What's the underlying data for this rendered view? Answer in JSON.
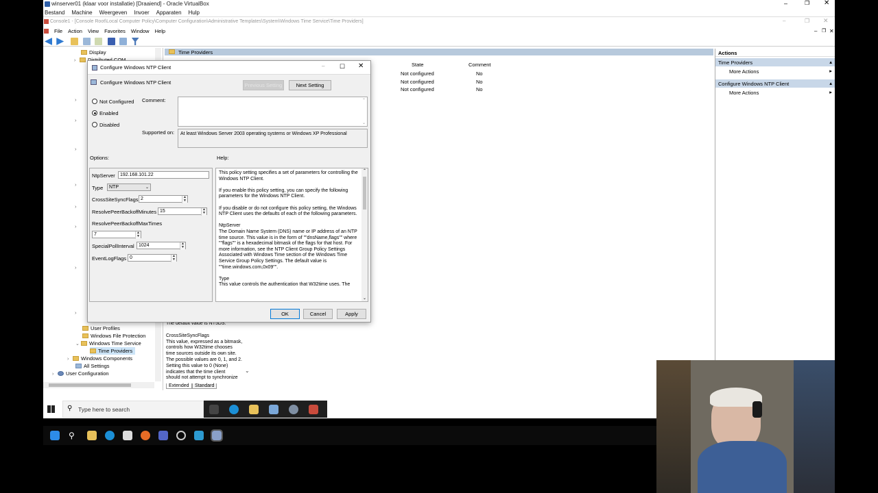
{
  "vbox": {
    "title": "winserver01 (klaar voor installatie) [Draaiend] - Oracle VirtualBox",
    "menu": [
      "Bestand",
      "Machine",
      "Weergeven",
      "Invoer",
      "Apparaten",
      "Hulp"
    ]
  },
  "mmc": {
    "title": "Console1 - [Console Root\\Local Computer Policy\\Computer Configuration\\Administrative Templates\\System\\Windows Time Service\\Time Providers]",
    "menu": [
      "File",
      "Action",
      "View",
      "Favorites",
      "Window",
      "Help"
    ]
  },
  "tree": {
    "top_items": [
      "Display",
      "Distributed COM"
    ],
    "bottom_items": [
      {
        "label": "User Profiles",
        "indent": 2
      },
      {
        "label": "Windows File Protection",
        "indent": 2
      },
      {
        "label": "Windows Time Service",
        "indent": 2
      },
      {
        "label": "Time Providers",
        "indent": 3
      },
      {
        "label": "Windows Components",
        "indent": 1
      },
      {
        "label": "All Settings",
        "indent": 1
      },
      {
        "label": "User Configuration",
        "indent": 0
      }
    ]
  },
  "center": {
    "header": "Time Providers",
    "columns": [
      "State",
      "Comment"
    ],
    "rows": [
      {
        "state": "Not configured",
        "comment": "No"
      },
      {
        "state": "Not configured",
        "comment": "No"
      },
      {
        "state": "Not configured",
        "comment": "No"
      }
    ],
    "bg_help": [
      "The default value is NT5DS.",
      "CrossSiteSyncFlags",
      "This value, expressed as a bitmask,",
      "controls how W32time chooses",
      "time sources outside its own site.",
      "The possible values are 0, 1, and 2.",
      "Setting this value to 0 (None)",
      "indicates that the time client",
      "should not attempt to synchronize"
    ],
    "tabs": [
      "Extended",
      "Standard"
    ]
  },
  "actions": {
    "header": "Actions",
    "sections": [
      {
        "title": "Time Providers",
        "item": "More Actions"
      },
      {
        "title": "Configure Windows NTP Client",
        "item": "More Actions"
      }
    ]
  },
  "dialog": {
    "title": "Configure Windows NTP Client",
    "heading": "Configure Windows NTP Client",
    "prev_button": "Previous Setting",
    "next_button": "Next Setting",
    "radio_not_configured": "Not Configured",
    "radio_enabled": "Enabled",
    "radio_disabled": "Disabled",
    "comment_label": "Comment:",
    "supported_label": "Supported on:",
    "supported_value": "At least Windows Server 2003 operating systems or Windows XP Professional",
    "options_label": "Options:",
    "help_label": "Help:",
    "options": {
      "ntpserver_label": "NtpServer",
      "ntpserver_value": "192.168.101.22",
      "type_label": "Type",
      "type_value": "NTP",
      "crosssite_label": "CrossSiteSyncFlags",
      "crosssite_value": "2",
      "resolvemin_label": "ResolvePeerBackoffMinutes",
      "resolvemin_value": "15",
      "resolvemax_label": "ResolvePeerBackoffMaxTimes",
      "resolvemax_value": "7",
      "special_label": "SpecialPollInterval",
      "special_value": "1024",
      "eventlog_label": "EventLogFlags",
      "eventlog_value": "0"
    },
    "help": [
      "This policy setting specifies a set of parameters for controlling the Windows NTP Client.",
      "If you enable this policy setting, you can specify the following parameters for the Windows NTP Client.",
      "If you disable or do not configure this policy setting, the Windows NTP Client uses the defaults of each of the following parameters.",
      "NtpServer",
      "The Domain Name System (DNS) name or IP address of an NTP time source. This value is in the form of \"\"dnsName,flags\"\" where \"\"flags\"\" is a hexadecimal bitmask of the flags for that host. For more information, see the NTP Client Group Policy Settings Associated with Windows Time section of the Windows Time Service Group Policy Settings.  The default value is \"\"time.windows.com,0x09\"\".",
      "Type",
      "This value controls the authentication that W32time uses. The"
    ],
    "ok": "OK",
    "cancel": "Cancel",
    "apply": "Apply"
  },
  "guest_taskbar": {
    "search_placeholder": "Type here to search"
  },
  "colors": {
    "accent": "#0078d7",
    "header_blue": "#b7c9dc",
    "folder": "#e8c15a"
  }
}
